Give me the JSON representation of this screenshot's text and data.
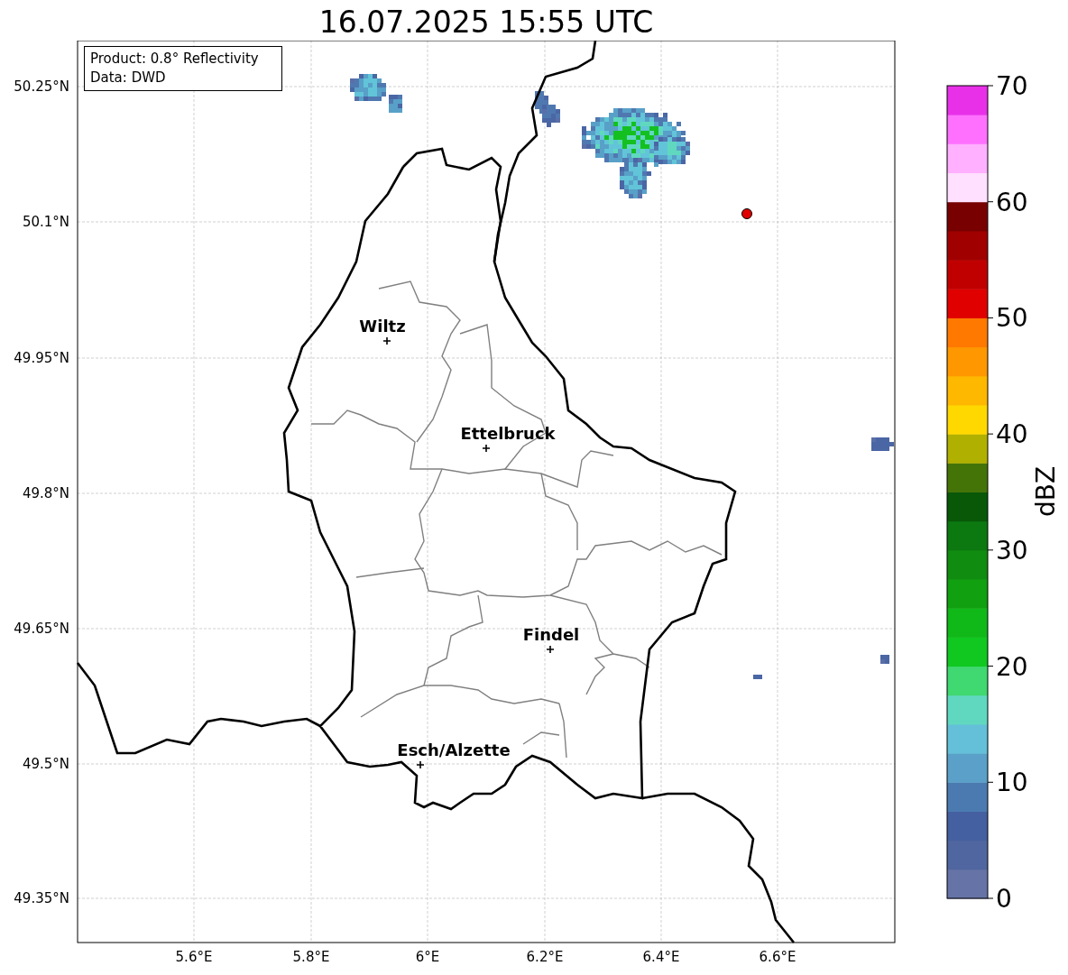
{
  "title": "16.07.2025 15:55 UTC",
  "info_box": [
    "Product: 0.8° Reflectivity",
    "Data: DWD"
  ],
  "map": {
    "cities": [
      {
        "name": "Wiltz"
      },
      {
        "name": "Ettelbruck"
      },
      {
        "name": "Findel"
      },
      {
        "name": "Esch/Alzette"
      }
    ],
    "yticks": [
      "50.25°N",
      "50.1°N",
      "49.95°N",
      "49.8°N",
      "49.65°N",
      "49.5°N",
      "49.35°N"
    ],
    "xticks": [
      "5.6°E",
      "5.8°E",
      "6°E",
      "6.2°E",
      "6.4°E",
      "6.6°E"
    ]
  },
  "colorbar": {
    "label": "dBZ",
    "ticks": [
      "70",
      "60",
      "50",
      "40",
      "30",
      "20",
      "10",
      "0"
    ],
    "bands": [
      {
        "color": "#6673a6"
      },
      {
        "color": "#5066a0"
      },
      {
        "color": "#4460a0"
      },
      {
        "color": "#4a7ab0"
      },
      {
        "color": "#5aa0c8"
      },
      {
        "color": "#64c0d8"
      },
      {
        "color": "#60d8c0"
      },
      {
        "color": "#40d870"
      },
      {
        "color": "#10c820"
      },
      {
        "color": "#10b818"
      },
      {
        "color": "#10a010"
      },
      {
        "color": "#108c10"
      },
      {
        "color": "#0c7810"
      },
      {
        "color": "#085808"
      },
      {
        "color": "#447408"
      },
      {
        "color": "#b0b000"
      },
      {
        "color": "#ffd800"
      },
      {
        "color": "#ffb800"
      },
      {
        "color": "#ff9800"
      },
      {
        "color": "#ff7800"
      },
      {
        "color": "#e00000"
      },
      {
        "color": "#c00000"
      },
      {
        "color": "#a00000"
      },
      {
        "color": "#780000"
      },
      {
        "color": "#ffe0ff"
      },
      {
        "color": "#ffb0ff"
      },
      {
        "color": "#ff70ff"
      },
      {
        "color": "#e830e8"
      }
    ]
  }
}
